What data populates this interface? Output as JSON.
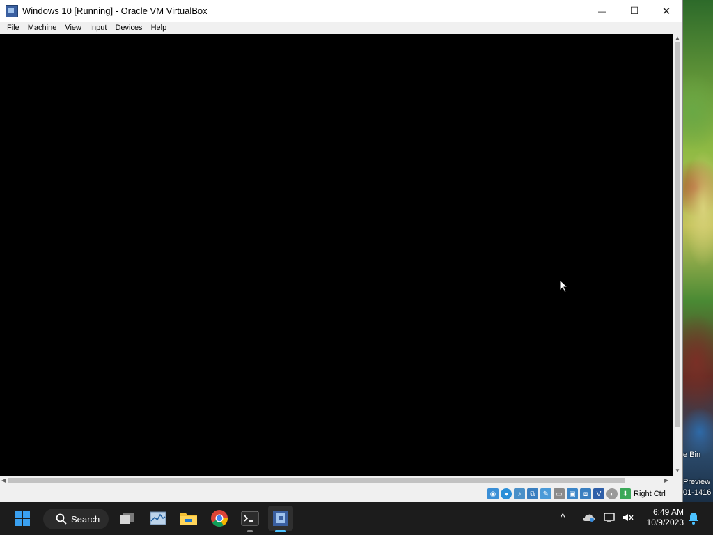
{
  "window": {
    "title": "Windows 10 [Running] - Oracle VM VirtualBox",
    "minimize_glyph": "—",
    "maximize_glyph": "☐",
    "close_glyph": "✕"
  },
  "menu": [
    "File",
    "Machine",
    "View",
    "Input",
    "Devices",
    "Help"
  ],
  "statusbar": {
    "host_key": "Right Ctrl",
    "icons": [
      "hard-disk-icon",
      "optical-drive-icon",
      "audio-icon",
      "network-icon",
      "usb-icon",
      "shared-folders-icon",
      "display-icon",
      "video-capture-icon",
      "vt-x-icon",
      "cpu-icon",
      "mouse-integration-icon",
      "keyboard-capture-icon"
    ]
  },
  "desktop": {
    "recycle_bin_partial": "e Bin",
    "watermark_line1": "Preview",
    "watermark_line2": "01-1416"
  },
  "taskbar": {
    "search_label": "Search",
    "time": "6:49 AM",
    "date": "10/9/2023",
    "tray_chevron": "^"
  }
}
